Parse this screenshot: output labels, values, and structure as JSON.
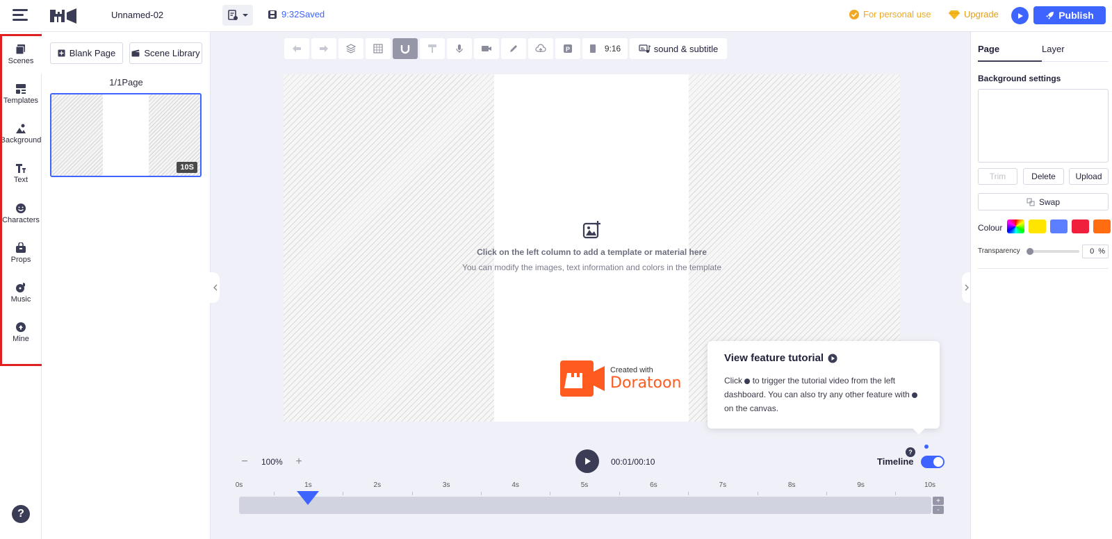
{
  "topbar": {
    "doc_title": "Unnamed-02",
    "save_status": "9:32Saved",
    "personal_use": "For personal use",
    "upgrade": "Upgrade",
    "publish": "Publish"
  },
  "leftnav": {
    "items": [
      {
        "label": "Scenes",
        "icon": "scenes-icon"
      },
      {
        "label": "Templates",
        "icon": "templates-icon"
      },
      {
        "label": "Background",
        "icon": "background-icon"
      },
      {
        "label": "Text",
        "icon": "text-icon"
      },
      {
        "label": "Characters",
        "icon": "characters-icon"
      },
      {
        "label": "Props",
        "icon": "props-icon"
      },
      {
        "label": "Music",
        "icon": "music-icon"
      },
      {
        "label": "Mine",
        "icon": "mine-icon"
      }
    ],
    "help": "?"
  },
  "scenes": {
    "blank_page": "Blank Page",
    "scene_library": "Scene Library",
    "page_count": "1/1Page",
    "duration": "10S"
  },
  "toolbar": {
    "ratio": "9:16",
    "sound_subtitle": "sound & subtitle"
  },
  "canvas": {
    "hint_primary": "Click on the left column to add a template or material here",
    "hint_secondary": "You can modify the images, text information and colors in the template",
    "watermark_created": "Created with",
    "watermark_brand": "Doratoon"
  },
  "tutorial": {
    "title": "View feature tutorial",
    "body_1": "Click",
    "body_2": "to trigger the tutorial video from the left dashboard. You can also try any other feature with",
    "body_3": "on the canvas."
  },
  "playback": {
    "zoom": "100%",
    "time": "00:01/00:10",
    "timeline_label": "Timeline",
    "timeline_on": true,
    "playhead_seconds": 1
  },
  "timeline": {
    "ticks": [
      "0s",
      "1s",
      "2s",
      "3s",
      "4s",
      "5s",
      "6s",
      "7s",
      "8s",
      "9s",
      "10s"
    ]
  },
  "rightpanel": {
    "tab_page": "Page",
    "tab_layer": "Layer",
    "bg_settings": "Background settings",
    "trim": "Trim",
    "delete": "Delete",
    "upload": "Upload",
    "swap": "Swap",
    "colour": "Colour",
    "swatches": [
      "rainbow",
      "#ffe500",
      "#5b7fff",
      "#f01f3c",
      "#ff6d10"
    ],
    "transparency": "Transparency",
    "transparency_value": "0",
    "percent": "%"
  },
  "colors": {
    "accent": "#3e64ff",
    "dark": "#3b3c55",
    "brand": "#ff5a1f",
    "highlight_border": "#e02020"
  }
}
